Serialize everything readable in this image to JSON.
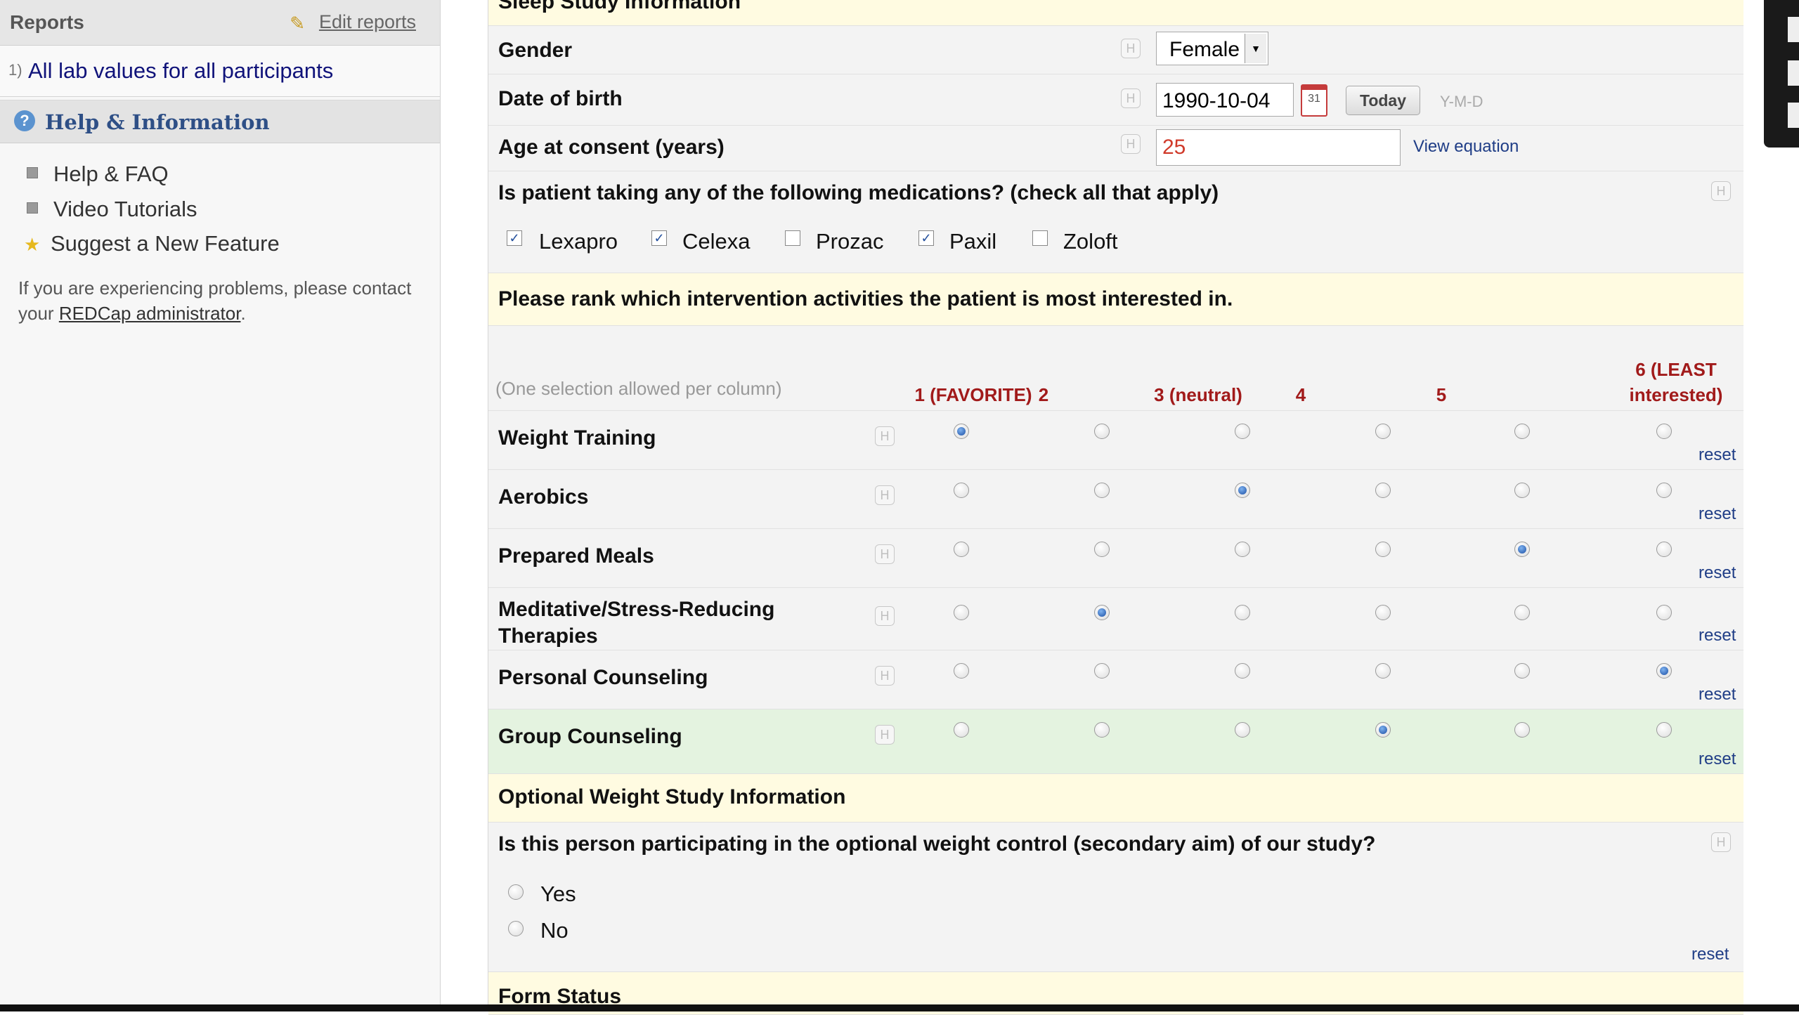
{
  "sidebar": {
    "reports_title": "Reports",
    "edit_reports": "Edit reports",
    "report_num": "1)",
    "report_link": "All lab values for all participants",
    "help_title": "Help & Information",
    "help_items": [
      "Help & FAQ",
      "Video Tutorials",
      "Suggest a New Feature"
    ],
    "note_prefix": "If you are experiencing problems, please contact your ",
    "note_link": "REDCap administrator",
    "note_suffix": "."
  },
  "form": {
    "section_title": "Sleep Study Information",
    "gender_label": "Gender",
    "gender_value": "Female",
    "dob_label": "Date of birth",
    "dob_value": "1990-10-04",
    "today_button": "Today",
    "date_format": "Y-M-D",
    "age_label": "Age at consent (years)",
    "age_value": "25",
    "view_equation": "View equation",
    "meds_question": "Is patient taking any of the following medications? (check all that apply)",
    "meds": [
      {
        "label": "Lexapro",
        "checked": true
      },
      {
        "label": "Celexa",
        "checked": true
      },
      {
        "label": "Prozac",
        "checked": false
      },
      {
        "label": "Paxil",
        "checked": true
      },
      {
        "label": "Zoloft",
        "checked": false
      }
    ],
    "rank_question": "Please rank which intervention activities the patient is most interested in.",
    "rank_note": "(One selection allowed per column)",
    "rank_columns": [
      "1 (FAVORITE)",
      "2",
      "3 (neutral)",
      "4",
      "5",
      "6 (LEAST interested)"
    ],
    "rank_col6_line1": "6 (LEAST",
    "rank_col6_line2": "interested)",
    "rank_rows": [
      {
        "label": "Weight Training",
        "selected": 1
      },
      {
        "label": "Aerobics",
        "selected": 3
      },
      {
        "label": "Prepared Meals",
        "selected": 5
      },
      {
        "label_line1": "Meditative/Stress-Reducing",
        "label_line2": "Therapies",
        "selected": 2
      },
      {
        "label": "Personal Counseling",
        "selected": 6
      },
      {
        "label": "Group Counseling",
        "selected": 4
      }
    ],
    "reset_label": "reset",
    "optional_section": "Optional Weight Study Information",
    "optional_question": "Is this person participating in the optional weight control (secondary aim) of our study?",
    "yes_label": "Yes",
    "no_label": "No",
    "form_status": "Form Status",
    "help_icon_glyph": "H"
  },
  "colors": {
    "yellow_row": "#fffbe1",
    "green_row": "#e4f3e0",
    "column_header": "#a11a1a",
    "link": "#1f3d86"
  }
}
